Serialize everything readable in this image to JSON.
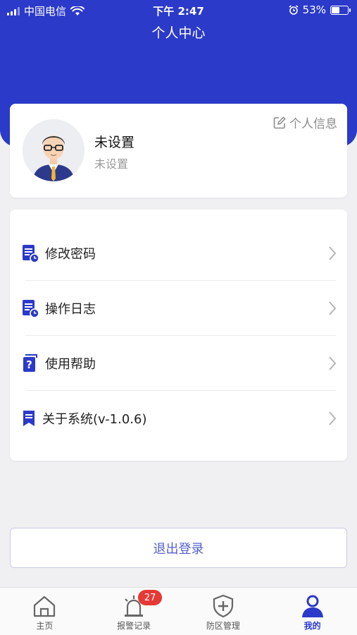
{
  "status_bar": {
    "carrier": "中国电信",
    "time": "下午 2:47",
    "battery": "53%",
    "battery_level": 0.53
  },
  "header": {
    "title": "个人中心"
  },
  "profile": {
    "name": "未设置",
    "subtitle": "未设置",
    "edit_label": "个人信息"
  },
  "menu": {
    "items": [
      {
        "label": "修改密码",
        "icon": "document-clock-icon"
      },
      {
        "label": "操作日志",
        "icon": "document-clock-icon"
      },
      {
        "label": "使用帮助",
        "icon": "help-document-icon"
      },
      {
        "label": "关于系统(v-1.0.6)",
        "icon": "bookmark-icon"
      }
    ]
  },
  "logout": {
    "label": "退出登录"
  },
  "tabbar": {
    "tabs": [
      {
        "label": "主页",
        "icon": "home-icon"
      },
      {
        "label": "报警记录",
        "icon": "alarm-light-icon",
        "badge": "27"
      },
      {
        "label": "防区管理",
        "icon": "shield-plus-icon"
      },
      {
        "label": "我的",
        "icon": "user-icon",
        "active": true
      }
    ]
  },
  "colors": {
    "primary": "#2b3ac9",
    "badge": "#e53935"
  }
}
